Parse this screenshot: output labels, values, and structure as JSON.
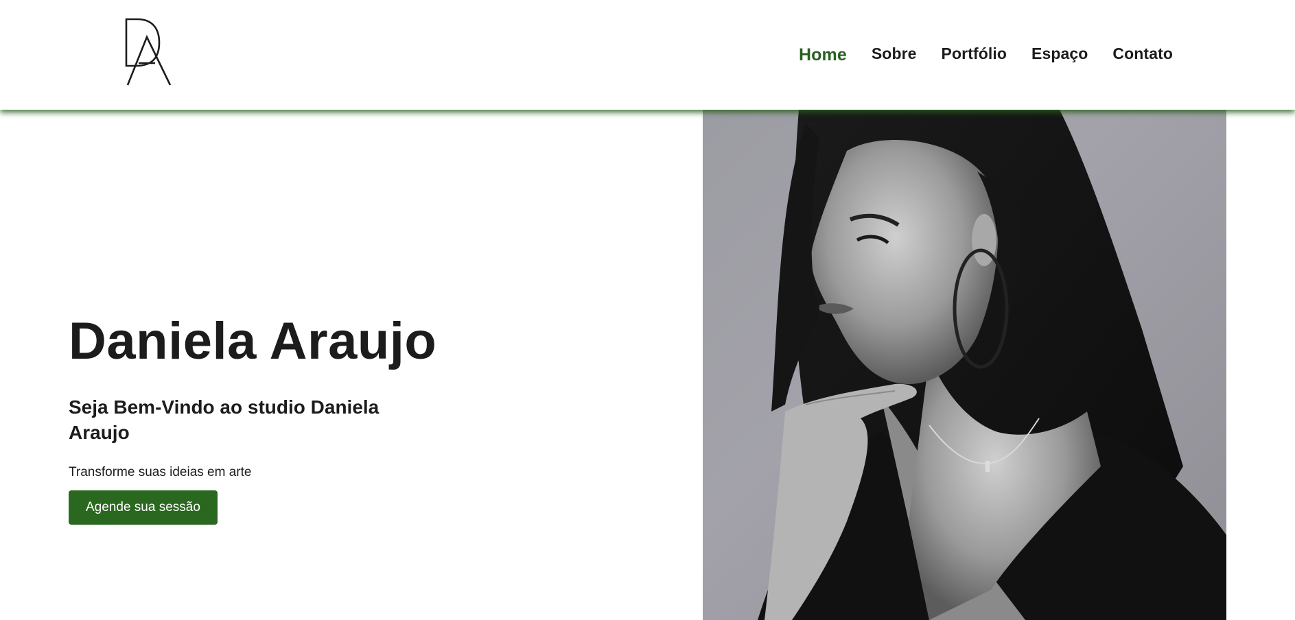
{
  "brand": {
    "logo_icon": "da-monogram-logo"
  },
  "nav": {
    "items": [
      {
        "label": "Home",
        "active": true
      },
      {
        "label": "Sobre",
        "active": false
      },
      {
        "label": "Portfólio",
        "active": false
      },
      {
        "label": "Espaço",
        "active": false
      },
      {
        "label": "Contato",
        "active": false
      }
    ]
  },
  "hero": {
    "title": "Daniela Araujo",
    "subtitle": "Seja Bem-Vindo ao studio Daniela Araujo",
    "tagline": "Transforme suas ideias em arte",
    "cta_label": "Agende sua sessão"
  },
  "colors": {
    "accent": "#276021",
    "button": "#2a681f",
    "text": "#1c1c1c"
  }
}
